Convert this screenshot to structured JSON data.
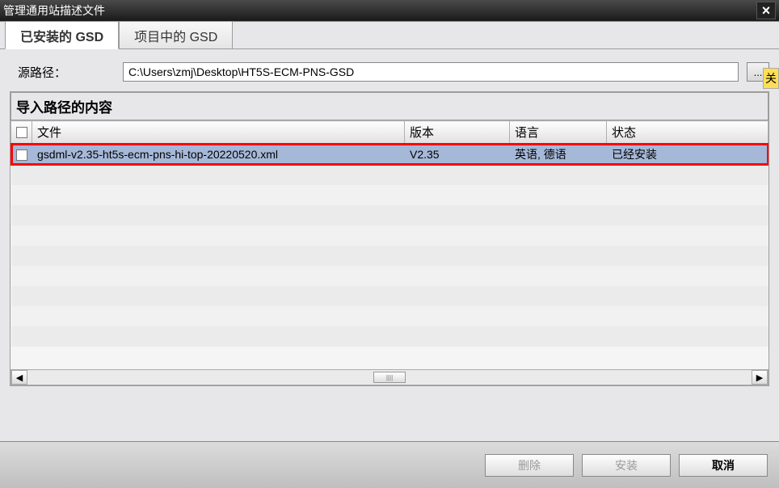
{
  "window": {
    "title": "管理通用站描述文件",
    "close_label": "×"
  },
  "tabs": {
    "installed": "已安装的 GSD",
    "in_project": "项目中的 GSD"
  },
  "source": {
    "label": "源路径：",
    "value": "C:\\Users\\zmj\\Desktop\\HT5S-ECM-PNS-GSD",
    "browse": "..."
  },
  "section": {
    "title": "导入路径的内容"
  },
  "cutoff_label": "关",
  "table": {
    "headers": {
      "file": "文件",
      "version": "版本",
      "language": "语言",
      "status": "状态"
    },
    "rows": [
      {
        "file": "gsdml-v2.35-ht5s-ecm-pns-hi-top-20220520.xml",
        "version": "V2.35",
        "language": "英语, 德语",
        "status": "已经安装"
      }
    ]
  },
  "buttons": {
    "delete": "删除",
    "install": "安装",
    "cancel": "取消"
  },
  "scroll": {
    "left": "◀",
    "right": "▶",
    "thumb": "||||"
  }
}
